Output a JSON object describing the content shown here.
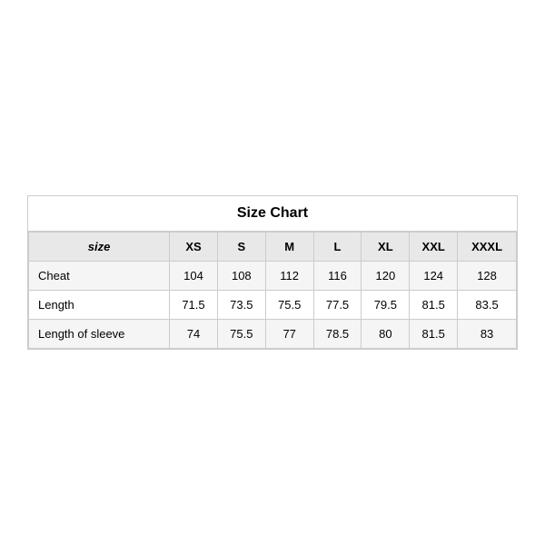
{
  "table": {
    "title": "Size Chart",
    "headers": {
      "size_label": "size",
      "columns": [
        "XS",
        "S",
        "M",
        "L",
        "XL",
        "XXL",
        "XXXL"
      ]
    },
    "rows": [
      {
        "label": "Cheat",
        "values": [
          "104",
          "108",
          "112",
          "116",
          "120",
          "124",
          "128"
        ]
      },
      {
        "label": "Length",
        "values": [
          "71.5",
          "73.5",
          "75.5",
          "77.5",
          "79.5",
          "81.5",
          "83.5"
        ]
      },
      {
        "label": "Length of sleeve",
        "values": [
          "74",
          "75.5",
          "77",
          "78.5",
          "80",
          "81.5",
          "83"
        ]
      }
    ]
  }
}
